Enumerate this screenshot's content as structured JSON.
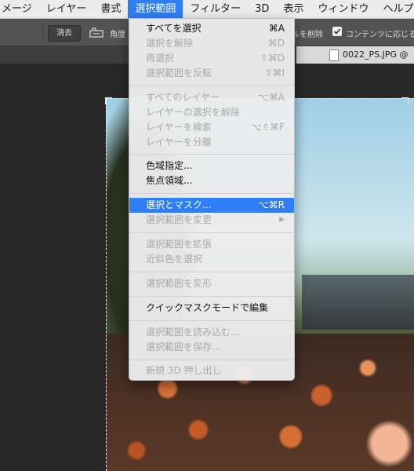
{
  "menubar": {
    "items": [
      "メージ",
      "レイヤー",
      "書式",
      "選択範囲",
      "フィルター",
      "3D",
      "表示",
      "ウィンドウ",
      "ヘルプ"
    ],
    "active_index": 3
  },
  "options_bar": {
    "clear_button": "消去",
    "angle_label": "角度",
    "delete_label": "ルを削除",
    "content_aware_label": "コンテンツに応じる"
  },
  "document_tab": {
    "title": "0022_PS.JPG @"
  },
  "select_menu": {
    "items": [
      {
        "label": "すべてを選択",
        "shortcut": "⌘A",
        "enabled": true
      },
      {
        "label": "選択を解除",
        "shortcut": "⌘D",
        "enabled": false
      },
      {
        "label": "再選択",
        "shortcut": "⇧⌘D",
        "enabled": false
      },
      {
        "label": "選択範囲を反転",
        "shortcut": "⇧⌘I",
        "enabled": false
      },
      {
        "label": "すべてのレイヤー",
        "shortcut": "⌥⌘A",
        "enabled": false
      },
      {
        "label": "レイヤーの選択を解除",
        "shortcut": "",
        "enabled": false
      },
      {
        "label": "レイヤーを検索",
        "shortcut": "⌥⇧⌘F",
        "enabled": false
      },
      {
        "label": "レイヤーを分離",
        "shortcut": "",
        "enabled": false
      },
      {
        "label": "色域指定...",
        "shortcut": "",
        "enabled": true
      },
      {
        "label": "焦点領域...",
        "shortcut": "",
        "enabled": true
      },
      {
        "label": "選択とマスク...",
        "shortcut": "⌥⌘R",
        "enabled": true,
        "highlighted": true
      },
      {
        "label": "選択範囲を変更",
        "shortcut": "",
        "enabled": false,
        "submenu": true
      },
      {
        "label": "選択範囲を拡張",
        "shortcut": "",
        "enabled": false
      },
      {
        "label": "近似色を選択",
        "shortcut": "",
        "enabled": false
      },
      {
        "label": "選択範囲を変形",
        "shortcut": "",
        "enabled": false
      },
      {
        "label": "クイックマスクモードで編集",
        "shortcut": "",
        "enabled": true
      },
      {
        "label": "選択範囲を読み込む...",
        "shortcut": "",
        "enabled": false
      },
      {
        "label": "選択範囲を保存...",
        "shortcut": "",
        "enabled": false
      },
      {
        "label": "新規 3D 押し出し",
        "shortcut": "",
        "enabled": false
      }
    ]
  },
  "colors": {
    "accent": "#2f7ef6"
  }
}
